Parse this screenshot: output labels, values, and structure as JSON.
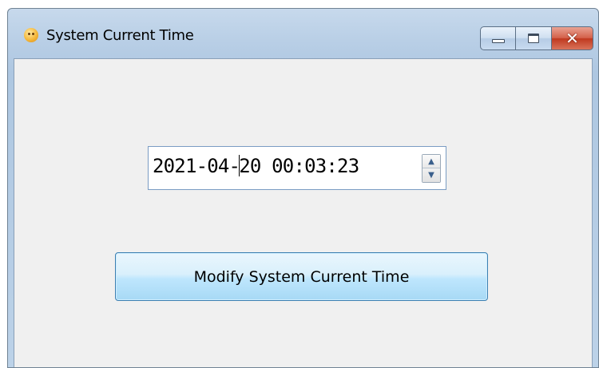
{
  "window": {
    "title": "System Current Time",
    "app_icon": "app-icon",
    "caption_buttons": {
      "minimize_icon": "minimize-icon",
      "maximize_icon": "maximize-icon",
      "close_glyph": "✕"
    }
  },
  "datetime_picker": {
    "value_before_caret": "2021-04-",
    "value_after_caret": "20 00:03:23",
    "spin_up_glyph": "▲",
    "spin_down_glyph": "▼"
  },
  "modify_button": {
    "label": "Modify System Current Time"
  },
  "colors": {
    "button_border": "#3c7fb1",
    "close_button": "#c0391f",
    "client_background": "#f0f0f0"
  }
}
